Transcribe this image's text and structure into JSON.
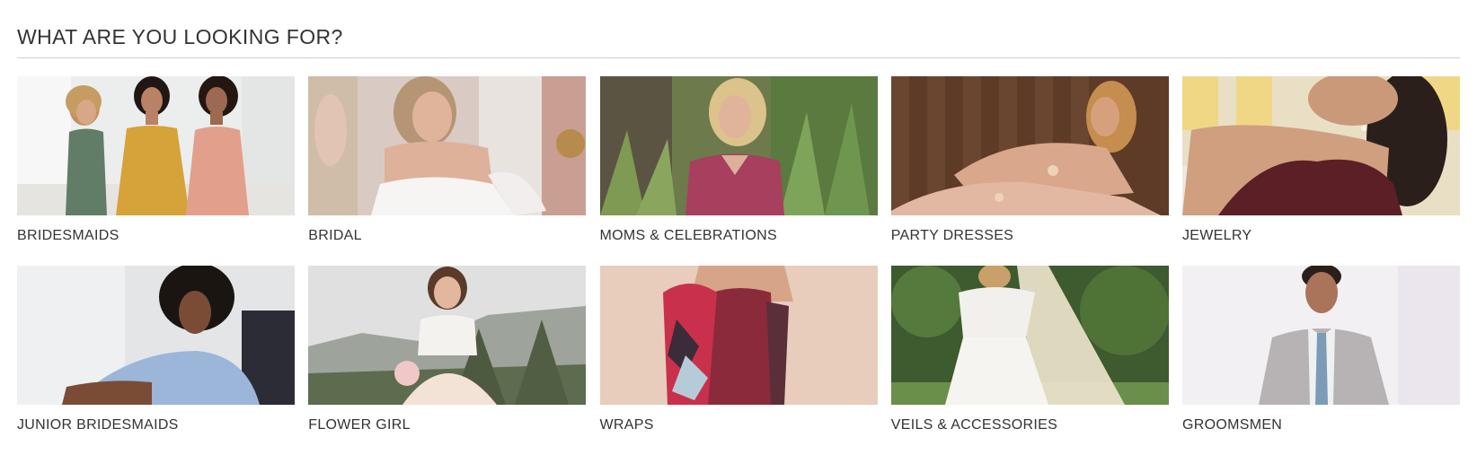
{
  "section": {
    "title": "WHAT ARE YOU LOOKING FOR?"
  },
  "colors": {
    "text": "#333333",
    "rule": "#cfcfcf"
  },
  "categories": [
    {
      "label": "BRIDESMAIDS",
      "name": "bridesmaids",
      "image": "three-bridesmaids-photo"
    },
    {
      "label": "BRIDAL",
      "name": "bridal",
      "image": "bride-in-strapless-gown-photo"
    },
    {
      "label": "MOMS & CELEBRATIONS",
      "name": "moms-celebrations",
      "image": "woman-in-lace-dress-outdoors-photo"
    },
    {
      "label": "PARTY DRESSES",
      "name": "party-dresses",
      "image": "woman-in-sequin-gown-reclining-photo"
    },
    {
      "label": "JEWELRY",
      "name": "jewelry",
      "image": "woman-wearing-earrings-and-necklace-photo"
    },
    {
      "label": "JUNIOR BRIDESMAIDS",
      "name": "junior-bridesmaids",
      "image": "girl-in-blue-ruffle-dress-photo"
    },
    {
      "label": "FLOWER GIRL",
      "name": "flower-girl",
      "image": "girl-holding-bouquet-photo"
    },
    {
      "label": "WRAPS",
      "name": "wraps",
      "image": "woman-in-patterned-wrap-photo"
    },
    {
      "label": "VEILS & ACCESSORIES",
      "name": "veils-accessories",
      "image": "bride-in-lace-veil-photo"
    },
    {
      "label": "GROOMSMEN",
      "name": "groomsmen",
      "image": "man-in-gray-suit-photo"
    }
  ]
}
